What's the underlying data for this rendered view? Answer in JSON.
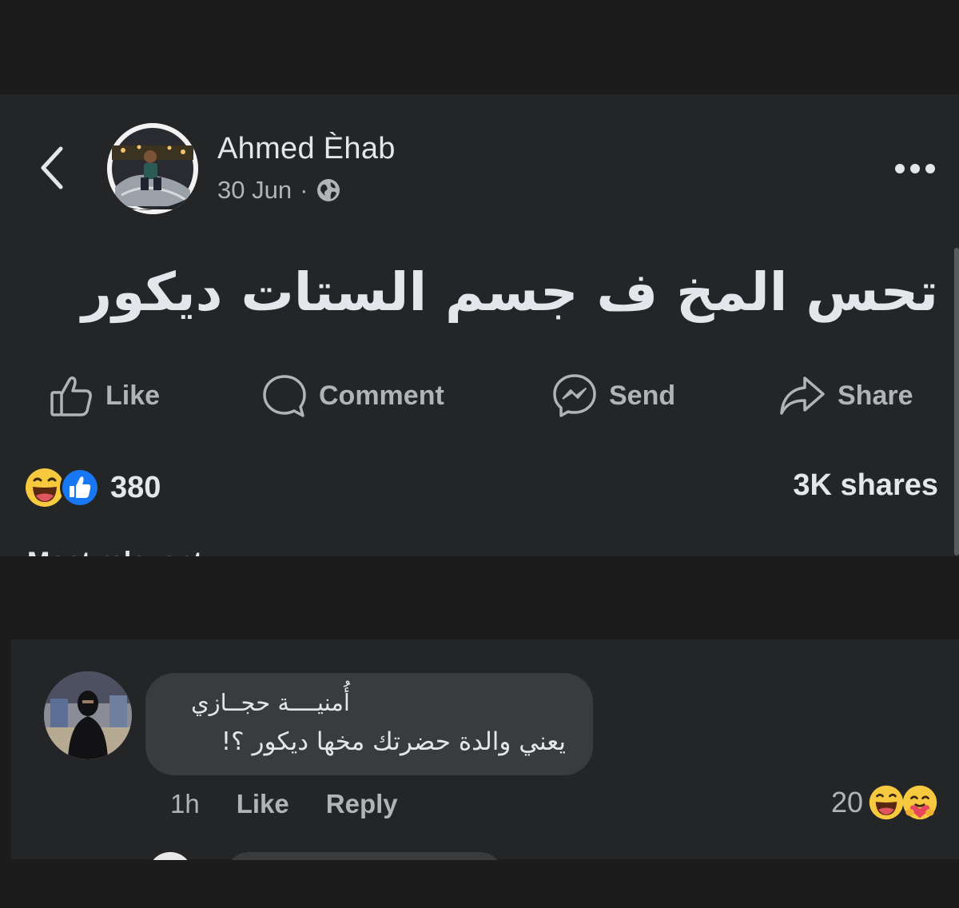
{
  "post": {
    "author": "Ahmed Èhab",
    "date": "30 Jun",
    "separator": "·",
    "text": "تحس المخ ف جسم الستات ديكور",
    "reaction_count": "380",
    "shares": "3K shares"
  },
  "actions": {
    "like": "Like",
    "comment": "Comment",
    "send": "Send",
    "share": "Share"
  },
  "comments_header": "Most relevant",
  "comment": {
    "author": "أُمنيــــة حجــازي",
    "text": "يعني والدة حضرتك مخها ديكور ؟!",
    "time": "1h",
    "like": "Like",
    "reply": "Reply",
    "reaction_count": "20"
  },
  "colors": {
    "background": "#1c1c1d",
    "panel": "#242526",
    "bubble": "#3a3b3c",
    "like_blue": "#1877f2",
    "haha_yellow": "#f7c93e"
  }
}
